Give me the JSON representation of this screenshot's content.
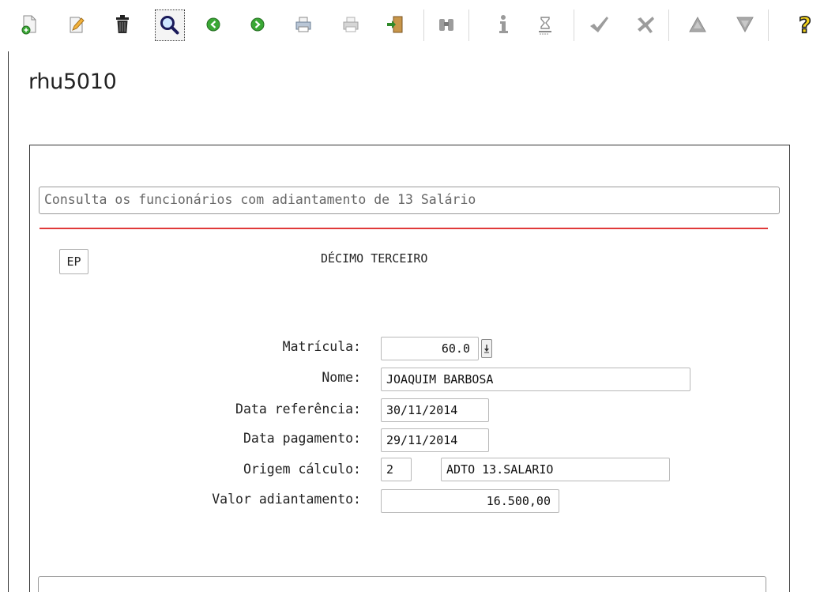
{
  "toolbar": {
    "buttons": [
      {
        "name": "new-record",
        "icon": "new-document-icon"
      },
      {
        "name": "edit-record",
        "icon": "pencil-icon"
      },
      {
        "name": "delete-record",
        "icon": "trash-icon"
      },
      {
        "name": "search",
        "icon": "magnifier-icon"
      },
      {
        "name": "previous",
        "icon": "arrow-left-icon"
      },
      {
        "name": "next",
        "icon": "arrow-right-icon"
      },
      {
        "name": "print",
        "icon": "printer-icon"
      },
      {
        "name": "print-disabled",
        "icon": "printer-icon"
      },
      {
        "name": "exit",
        "icon": "exit-door-icon"
      },
      {
        "name": "zoom",
        "icon": "binoculars-icon"
      },
      {
        "name": "info",
        "icon": "info-icon"
      },
      {
        "name": "hourglass",
        "icon": "hourglass-icon"
      },
      {
        "name": "confirm",
        "icon": "checkmark-icon"
      },
      {
        "name": "cancel",
        "icon": "cancel-icon"
      },
      {
        "name": "up",
        "icon": "triangle-up-icon"
      },
      {
        "name": "down",
        "icon": "triangle-down-icon"
      },
      {
        "name": "help",
        "icon": "question-icon"
      }
    ]
  },
  "program": {
    "title": "rhu5010"
  },
  "form": {
    "description": "Consulta os funcionários com adiantamento de 13 Salário",
    "ep_button": "EP",
    "section_title": "DÉCIMO TERCEIRO",
    "labels": {
      "matricula": "Matrícula:",
      "nome": "Nome:",
      "data_referencia": "Data referência:",
      "data_pagamento": "Data pagamento:",
      "origem_calculo": "Origem cálculo:",
      "valor_adiantamento": "Valor adiantamento:"
    },
    "values": {
      "matricula": "60.0",
      "nome": "JOAQUIM BARBOSA",
      "data_referencia": "30/11/2014",
      "data_pagamento": "29/11/2014",
      "origem_codigo": "2",
      "origem_descricao": "ADTO 13.SALARIO",
      "valor_adiantamento": "16.500,00"
    }
  },
  "colors": {
    "accent_red": "#e03a3a",
    "icon_green": "#3aa835",
    "help_yellow": "#f2d21b"
  }
}
